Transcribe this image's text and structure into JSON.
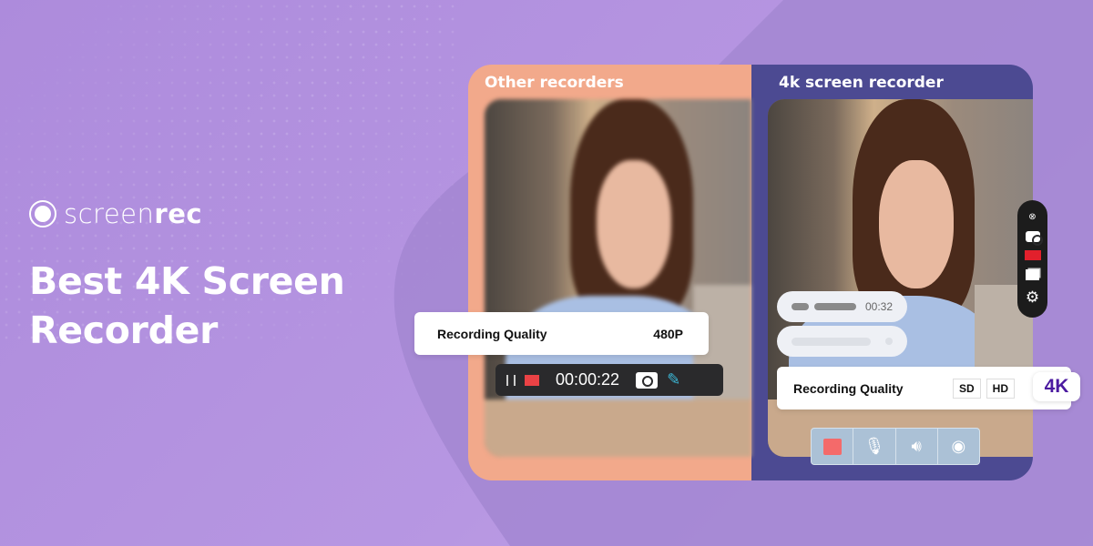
{
  "brand": {
    "name_light": "screen",
    "name_bold": "rec"
  },
  "headline": "Best 4K Screen Recorder",
  "comparison": {
    "left_title": "Other recorders",
    "right_title": "4k screen recorder"
  },
  "left_panel": {
    "quality_label": "Recording Quality",
    "quality_value": "480P",
    "toolbar": {
      "timer": "00:00:22",
      "icons": [
        "pause-icon",
        "stop-icon",
        "camera-icon",
        "pen-icon"
      ]
    }
  },
  "right_panel": {
    "audio_time": "00:32",
    "quality_label": "Recording Quality",
    "options": [
      "SD",
      "HD",
      "4K"
    ],
    "selected": "4K",
    "toolbar_icons": [
      "record-icon",
      "microphone-icon",
      "speaker-icon",
      "webcam-icon"
    ],
    "side_icons": [
      "close-icon",
      "camera-icon",
      "video-icon",
      "window-icon",
      "gear-icon"
    ]
  },
  "colors": {
    "background": "#b293df",
    "left_panel": "#f2a98b",
    "right_panel": "#4c4a92",
    "accent_4k": "#4b1aa0",
    "record_red": "#ea4245"
  }
}
